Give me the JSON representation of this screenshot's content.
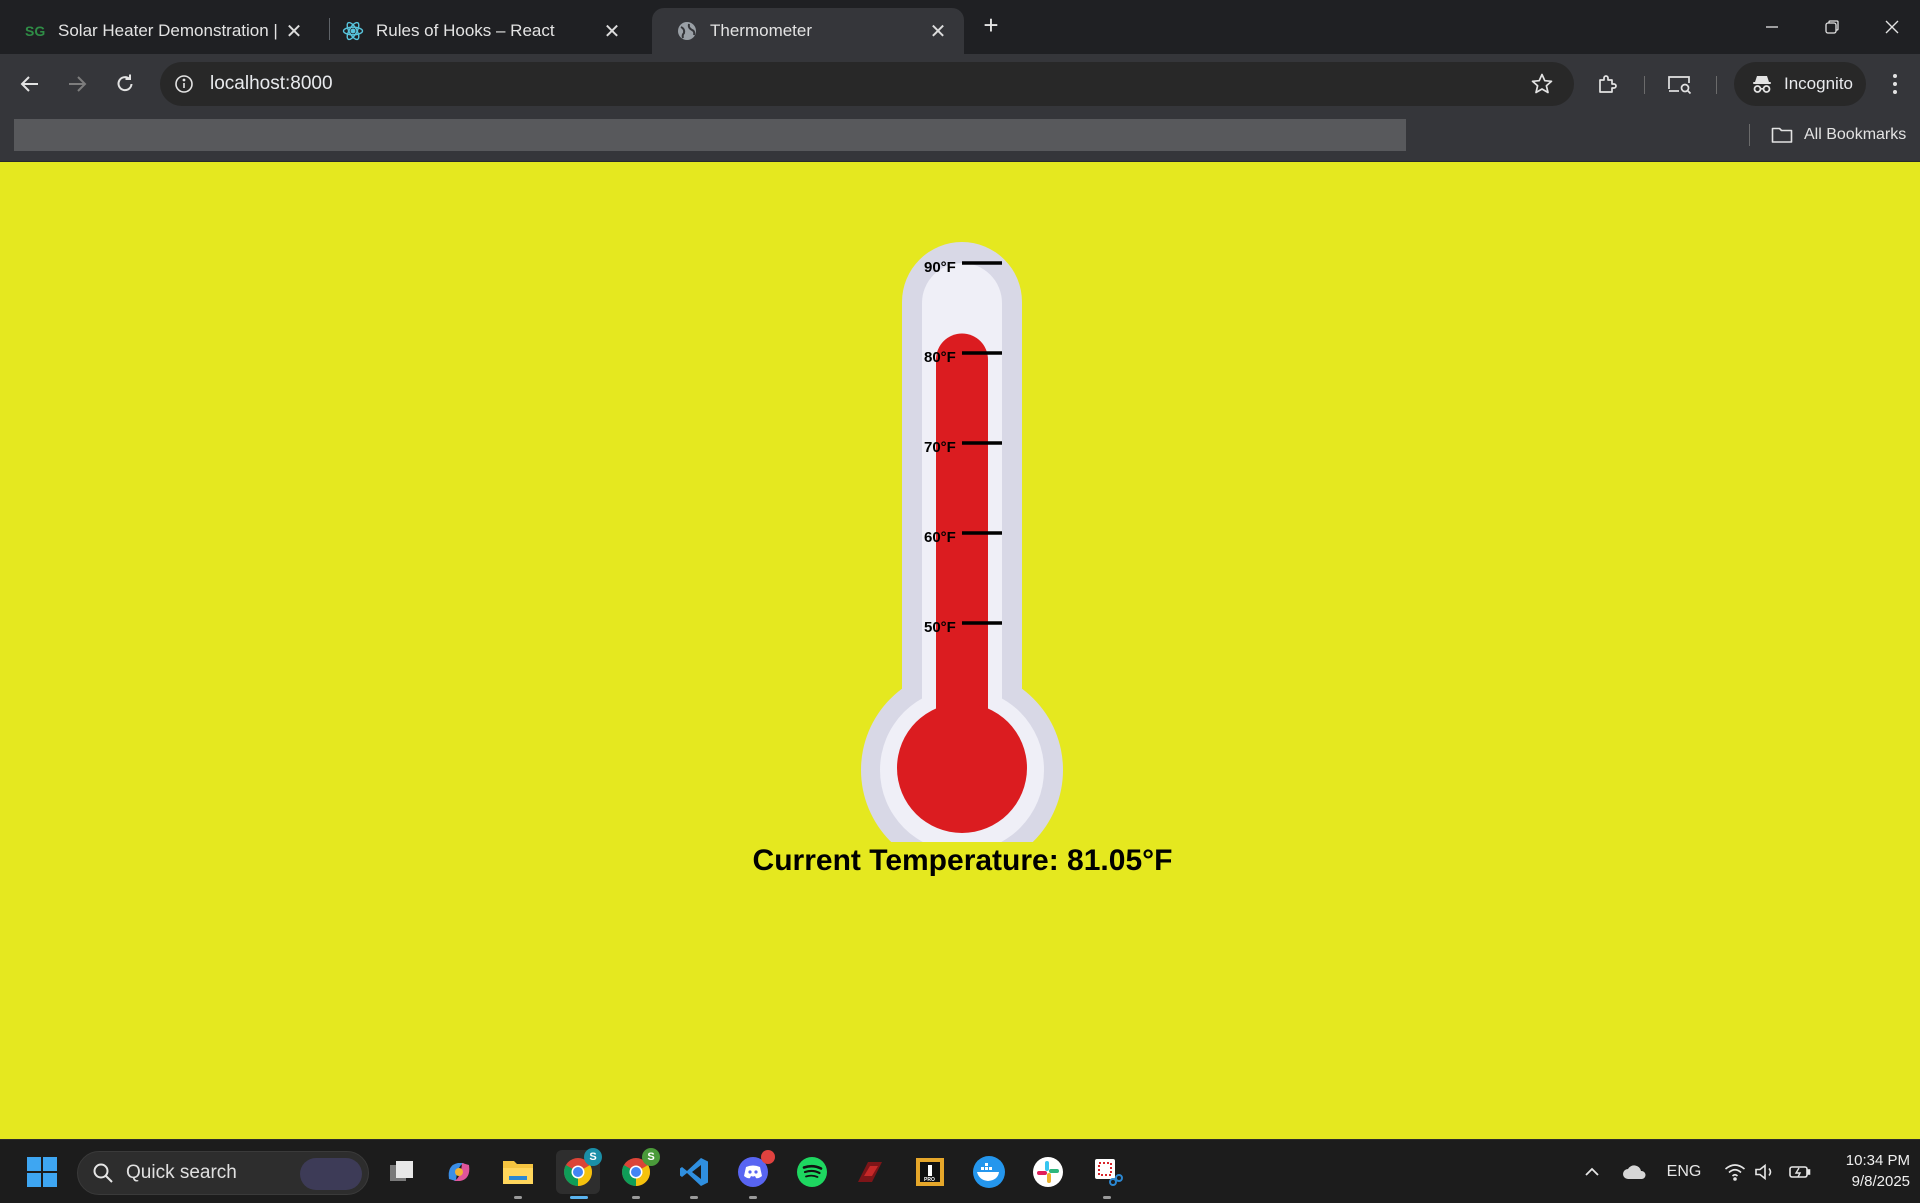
{
  "browser": {
    "tabs": [
      {
        "title": "Solar Heater Demonstration | Sc",
        "favicon": "sg-logo-icon",
        "active": false
      },
      {
        "title": "Rules of Hooks – React",
        "favicon": "react-logo-icon",
        "active": false
      },
      {
        "title": "Thermometer",
        "favicon": "globe-icon",
        "active": true
      }
    ],
    "address": "localhost:8000",
    "profile_label": "Incognito",
    "bookmarks_label": "All Bookmarks"
  },
  "page": {
    "readout_label": "Current Temperature: 81.05°F",
    "thermometer": {
      "unit": "°F",
      "current_value": 81.05,
      "ticks": [
        "90°F",
        "80°F",
        "70°F",
        "60°F",
        "50°F"
      ],
      "colors": {
        "background": "#e5e81f",
        "mercury": "#db1c20",
        "tube_outer": "#d8d8e6",
        "tube_inner": "#efeff7",
        "tick": "#000000"
      }
    }
  },
  "taskbar": {
    "search_label": "Quick search",
    "language": "ENG",
    "time": "10:34 PM",
    "date": "9/8/2025",
    "apps": [
      "start-icon",
      "task-view-icon",
      "copilot-icon",
      "file-explorer-icon",
      "chrome-icon",
      "chrome-profile-icon",
      "vscode-icon",
      "discord-icon",
      "spotify-icon",
      "red-app-icon",
      "intellij-icon",
      "docker-icon",
      "slack-icon",
      "snipping-tool-icon"
    ]
  }
}
